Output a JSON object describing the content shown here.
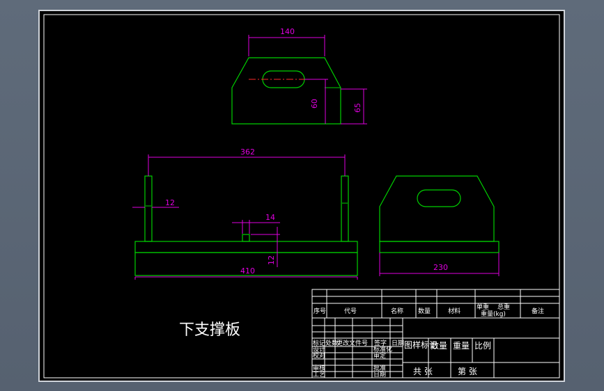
{
  "drawing": {
    "part_title": "下支撑板",
    "colors": {
      "background": "#000000",
      "outline": "#00d000",
      "dimension": "#e000e0",
      "centerline": "#ff2a2a",
      "frame": "#ffffff",
      "workspace": "#5a6573"
    },
    "views": {
      "top": {
        "dim_width": "140",
        "dim_height_slot": "60",
        "dim_height_total": "65"
      },
      "front": {
        "dim_length": "362",
        "dim_post": "12",
        "dim_notch_width": "14",
        "dim_base_height": "12",
        "dim_total_length": "410"
      },
      "side": {
        "dim_width": "230"
      }
    },
    "title_block": {
      "header": [
        "序号",
        "代号",
        "名称",
        "数量",
        "材料",
        "单重",
        "总重",
        "重量(kg)",
        "备注"
      ],
      "mark": "图样标记",
      "qty": "数量",
      "weight": "重量",
      "scale": "比例",
      "sheets_total": "共 张",
      "sheet_no": "第 张",
      "rev_row": [
        "标记",
        "处数",
        "更改文件号",
        "签字",
        "日期"
      ],
      "roles": [
        "设计",
        "校对",
        "审核",
        "工艺"
      ],
      "std": [
        "标准化",
        "审定",
        "批准",
        "日期"
      ]
    }
  }
}
